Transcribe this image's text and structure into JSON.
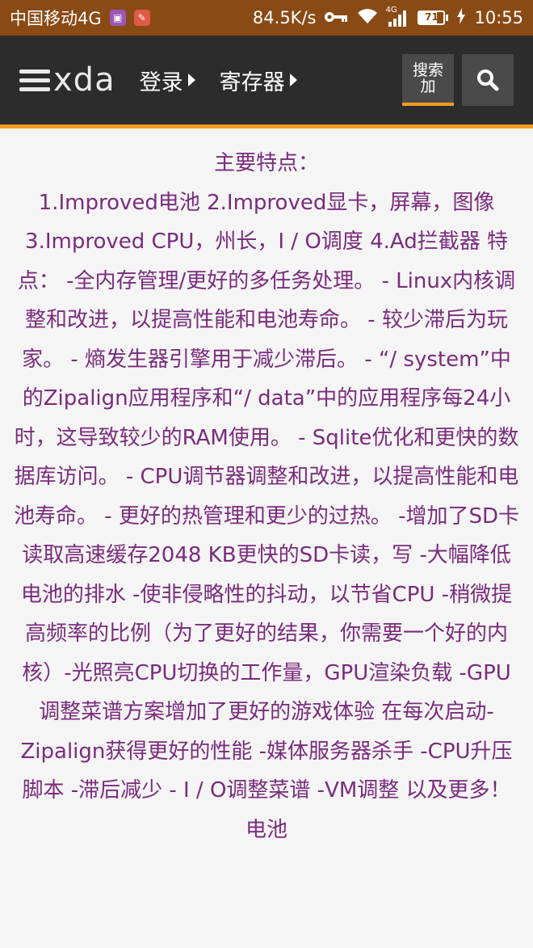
{
  "status_bar": {
    "carrier": "中国移动4G",
    "speed": "84.5K/s",
    "network": "4G",
    "battery_level": "71",
    "battery_fraction": 0.71,
    "time": "10:55",
    "icons": [
      "gallery-icon",
      "app-icon",
      "key-icon",
      "wifi-icon",
      "signal-icon",
      "battery-icon",
      "charging-icon"
    ]
  },
  "header": {
    "logo_text": "xda",
    "nav": {
      "login_label": "登录",
      "register_label": "寄存器"
    },
    "search_tab_label": "搜索\n加",
    "search_icon": "search-icon"
  },
  "content": {
    "title": "主要特点：",
    "body": "1.Improved电池 2.Improved显卡，屏幕，图像 3.Improved CPU，州长，I / O调度 4.Ad拦截器 特点： -全内存管理/更好的多任务处理。 - Linux内核调整和改进，以提高性能和电池寿命。 - 较少滞后为玩家。 - 熵发生器引擎用于减少滞后。 - “/ system”中的Zipalign应用程序和“/ data”中的应用程序每24小时，这导致较少的RAM使用。 - Sqlite优化和更快的数据库访问。 - CPU调节器调整和改进，以提高性能和电池寿命。 - 更好的热管理和更少的过热。 -增加了SD卡读取高速缓存2048 KB更快的SD卡读，写 -大幅降低电池的排水 -使非侵略性的抖动，以节省CPU -稍微提高频率的比例（为了更好的结果，你需要一个好的内核）-光照亮CPU切换的工作量，GPU渲染负载 -GPU调整菜谱方案增加了更好的游戏体验 在每次启动-Zipalign获得更好的性能 -媒体服务器杀手 -CPU升压脚本 -滞后减少 - I / O调整菜谱 -VM调整 以及更多！ 电池"
  },
  "colors": {
    "status_bar_bg": "#8a4a14",
    "header_bg": "#2c2c2c",
    "accent": "#f59a23",
    "content_text": "#7a2b7d",
    "page_bg": "#f5f5f5"
  }
}
